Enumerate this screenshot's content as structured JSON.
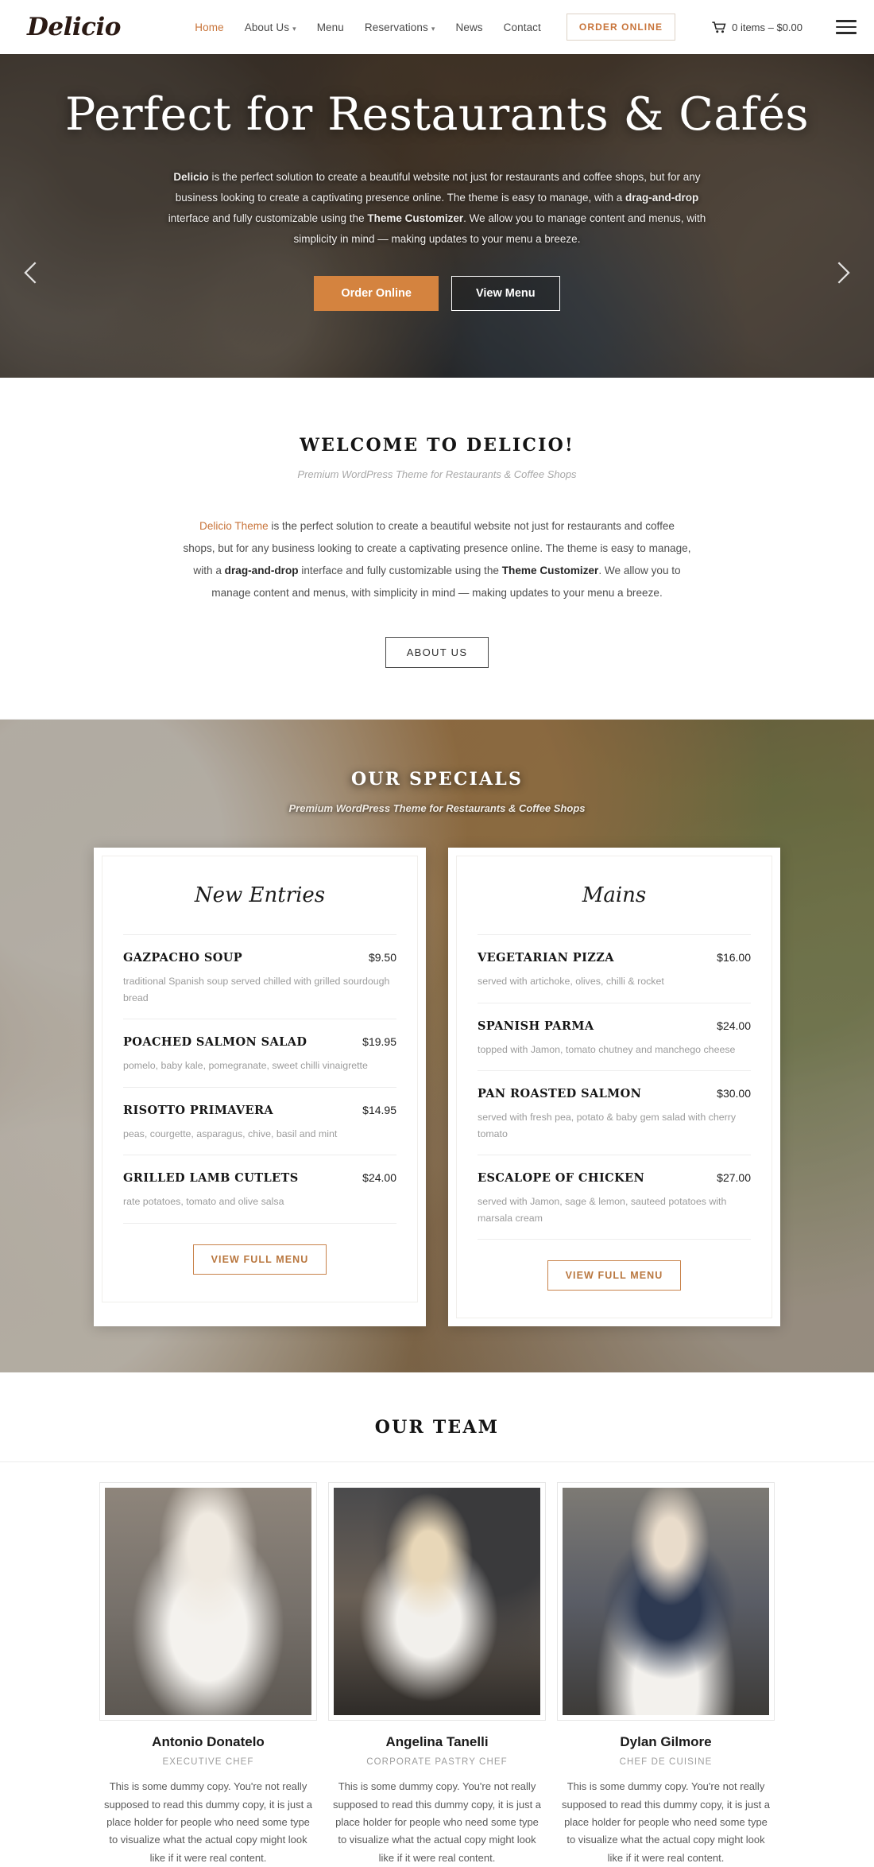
{
  "header": {
    "brand": "Delicio",
    "nav": [
      {
        "label": "Home",
        "active": true,
        "caret": false
      },
      {
        "label": "About Us",
        "active": false,
        "caret": true
      },
      {
        "label": "Menu",
        "active": false,
        "caret": false
      },
      {
        "label": "Reservations",
        "active": false,
        "caret": true
      },
      {
        "label": "News",
        "active": false,
        "caret": false
      },
      {
        "label": "Contact",
        "active": false,
        "caret": false
      }
    ],
    "order_online_label": "ORDER ONLINE",
    "cart_text": "0 items – $0.00",
    "cart_icon": "shopping-cart-icon",
    "menu_icon": "hamburger-menu-icon",
    "accent_color": "#c8743a"
  },
  "hero": {
    "title": "Perfect for Restaurants & Cafés",
    "desc_1": "Delicio",
    "desc_2": " is the perfect solution to create a beautiful website not just for restaurants and coffee shops, but for any business looking to create a captivating presence online. The theme is easy to manage, with a ",
    "desc_3": "drag-and-drop",
    "desc_4": " interface and fully customizable using the ",
    "desc_5": "Theme Customizer",
    "desc_6": ". We allow you to manage content and menus, with simplicity in mind — making updates to your menu a breeze.",
    "btn_primary": "Order Online",
    "btn_secondary": "View Menu",
    "prev_icon": "chevron-left-icon",
    "next_icon": "chevron-right-icon",
    "primary_color": "#d4833f"
  },
  "welcome": {
    "title": "WELCOME TO DELICIO!",
    "subtitle": "Premium WordPress Theme for Restaurants & Coffee Shops",
    "body_1": "Delicio Theme",
    "body_2": " is the perfect solution to create a beautiful website not just for restaurants and coffee shops, but for any business looking to create a captivating presence online. The theme is easy to manage, with a ",
    "body_3": "drag-and-drop",
    "body_4": " interface and fully customizable using the ",
    "body_5": "Theme Customizer",
    "body_6": ". We allow you to manage content and menus, with simplicity in mind — making updates to your menu a breeze.",
    "button": "ABOUT US"
  },
  "specials": {
    "title": "OUR SPECIALS",
    "subtitle": "Premium WordPress Theme for Restaurants & Coffee Shops",
    "cards": [
      {
        "title": "New Entries",
        "button": "VIEW FULL MENU",
        "items": [
          {
            "name": "GAZPACHO SOUP",
            "price": "$9.50",
            "desc": "traditional Spanish soup served chilled with grilled sourdough bread"
          },
          {
            "name": "POACHED SALMON SALAD",
            "price": "$19.95",
            "desc": "pomelo, baby kale, pomegranate, sweet chilli vinaigrette"
          },
          {
            "name": "RISOTTO PRIMAVERA",
            "price": "$14.95",
            "desc": "peas, courgette, asparagus, chive, basil and mint"
          },
          {
            "name": "GRILLED LAMB CUTLETS",
            "price": "$24.00",
            "desc": "rate potatoes, tomato and olive salsa"
          }
        ]
      },
      {
        "title": "Mains",
        "button": "VIEW FULL MENU",
        "items": [
          {
            "name": "VEGETARIAN PIZZA",
            "price": "$16.00",
            "desc": "served with artichoke, olives, chilli & rocket"
          },
          {
            "name": "SPANISH PARMA",
            "price": "$24.00",
            "desc": "topped with Jamon, tomato chutney and manchego cheese"
          },
          {
            "name": "PAN ROASTED SALMON",
            "price": "$30.00",
            "desc": "served with fresh pea, potato & baby gem salad with cherry tomato"
          },
          {
            "name": "ESCALOPE OF CHICKEN",
            "price": "$27.00",
            "desc": "served with Jamon, sage & lemon, sauteed potatoes with marsala cream"
          }
        ]
      }
    ]
  },
  "team": {
    "title": "OUR TEAM",
    "members": [
      {
        "name": "Antonio Donatelo",
        "role": "EXECUTIVE CHEF",
        "bio": "This is some dummy copy. You're not really supposed to read this dummy copy, it is just a place holder for people who need some type to visualize what the actual copy might look like if it were real content."
      },
      {
        "name": "Angelina Tanelli",
        "role": "CORPORATE PASTRY CHEF",
        "bio": "This is some dummy copy. You're not really supposed to read this dummy copy, it is just a place holder for people who need some type to visualize what the actual copy might look like if it were real content."
      },
      {
        "name": "Dylan Gilmore",
        "role": "CHEF DE CUISINE",
        "bio": "This is some dummy copy. You're not really supposed to read this dummy copy, it is just a place holder for people who need some type to visualize what the actual copy might look like if it were real content."
      }
    ]
  }
}
